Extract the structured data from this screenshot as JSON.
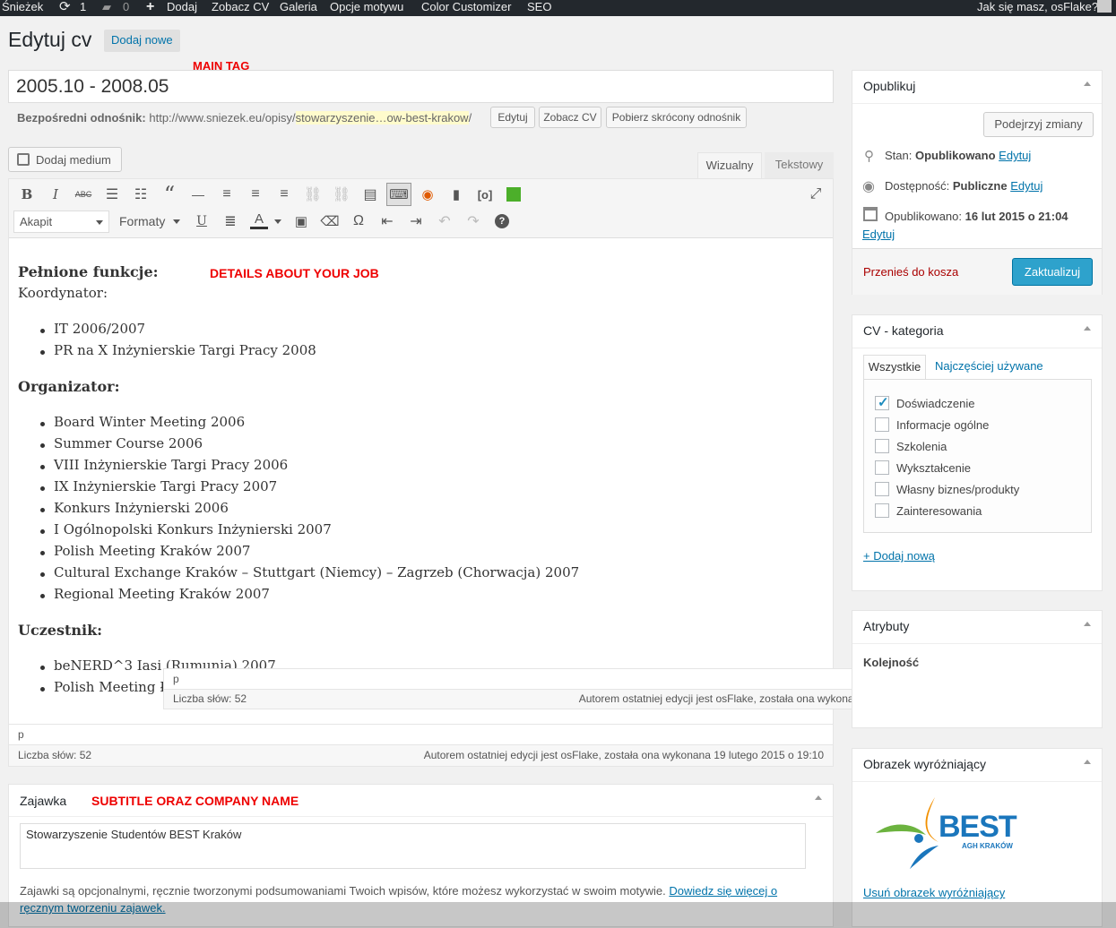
{
  "adminbar": {
    "site": "Śnieżek",
    "updates": "1",
    "comments": "0",
    "add": "Dodaj",
    "view_cv": "Zobacz CV",
    "gallery": "Galeria",
    "theme_options": "Opcje motywu",
    "color_customizer": "Color Customizer",
    "seo": "SEO",
    "greeting": "Jak się masz, osFlake?"
  },
  "header": {
    "title": "Edytuj cv",
    "add_new": "Dodaj nowe",
    "main_tag_note": "MAIN TAG"
  },
  "post": {
    "title": "2005.10 - 2008.05",
    "permalink_label": "Bezpośredni odnośnik:",
    "permalink_base": "http://www.sniezek.eu/opisy/",
    "permalink_slug": "stowarzyszenie…ow-best-krakow",
    "permalink_end": "/",
    "edit_btn": "Edytuj",
    "view_btn": "Zobacz CV",
    "shortlink_btn": "Pobierz skrócony odnośnik"
  },
  "editor": {
    "add_media": "Dodaj medium",
    "tab_visual": "Wizualny",
    "tab_text": "Tekstowy",
    "format_select": "Akapit",
    "formats_menu": "Formaty",
    "details_note": "DETAILS ABOUT YOUR JOB",
    "heading1": "Pełnione funkcje:",
    "line1": "Koordynator:",
    "list1": [
      "IT 2006/2007",
      "PR na X Inżynierskie Targi Pracy 2008"
    ],
    "heading2": "Organizator:",
    "list2": [
      "Board Winter Meeting 2006",
      "Summer Course 2006",
      "VIII Inżynierskie Targi Pracy 2006",
      "IX Inżynierskie Targi Pracy 2007",
      "Konkurs Inżynierski 2006",
      "I Ogólnopolski Konkurs Inżynierski 2007",
      "Polish Meeting Kraków 2007",
      "Cultural Exchange Kraków – Stuttgart (Niemcy) – Zagrzeb (Chorwacja) 2007",
      "Regional Meeting Kraków 2007"
    ],
    "heading3": "Uczestnik:",
    "list3": [
      "beNERD^3 Iasi (Rumunia) 2007",
      "Polish Meeting Łó"
    ],
    "path": "p",
    "word_count": "Liczba słów: 52",
    "last_edit": "Autorem ostatniej edycji jest osFlake, została ona wykonana 19 lutego 2015 o 19:10"
  },
  "excerpt": {
    "title": "Zajawka",
    "note": "SUBTITLE ORAZ COMPANY NAME",
    "value": "Stowarzyszenie Studentów BEST Kraków",
    "help": "Zajawki są opcjonalnymi, ręcznie tworzonymi podsumowaniami Twoich wpisów, które możesz wykorzystać w swoim motywie.",
    "help_link": "Dowiedz się więcej o ręcznym tworzeniu zajawek."
  },
  "publish": {
    "title": "Opublikuj",
    "preview": "Podejrzyj zmiany",
    "status_label": "Stan:",
    "status_value": "Opublikowano",
    "visibility_label": "Dostępność:",
    "visibility_value": "Publiczne",
    "published_label": "Opublikowano:",
    "published_value": "16 lut 2015 o 21:04",
    "edit": "Edytuj",
    "trash": "Przenieś do kosza",
    "update": "Zaktualizuj"
  },
  "category": {
    "title": "CV - kategoria",
    "tab_all": "Wszystkie",
    "tab_popular": "Najczęściej używane",
    "items": [
      {
        "label": "Doświadczenie",
        "checked": true
      },
      {
        "label": "Informacje ogólne",
        "checked": false
      },
      {
        "label": "Szkolenia",
        "checked": false
      },
      {
        "label": "Wykształcenie",
        "checked": false
      },
      {
        "label": "Własny biznes/produkty",
        "checked": false
      },
      {
        "label": "Zainteresowania",
        "checked": false
      }
    ],
    "add_new": "+ Dodaj nową"
  },
  "attributes": {
    "title": "Atrybuty",
    "order_label": "Kolejność"
  },
  "featured": {
    "title": "Obrazek wyróżniający",
    "logo_text": "BEST",
    "logo_sub": "AGH KRAKÓW",
    "remove": "Usuń obrazek wyróżniający"
  },
  "colors": {
    "accent": "#0073aa",
    "update_btn": "#2ea2cc",
    "adminbar": "#23282d",
    "annotation": "#ee0000"
  }
}
